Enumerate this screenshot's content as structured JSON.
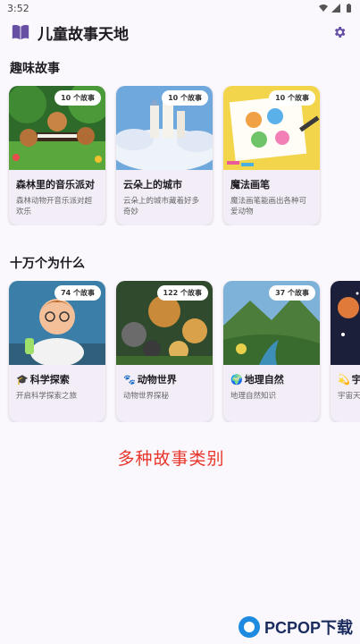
{
  "status_bar": {
    "time": "3:52"
  },
  "header": {
    "title": "儿童故事天地",
    "logo_icon": "book-icon",
    "settings_icon": "gear-icon"
  },
  "sections": [
    {
      "title": "趣味故事",
      "cards": [
        {
          "badge": "10 个故事",
          "title": "森林里的音乐派对",
          "desc": "森林动物开音乐派对超欢乐",
          "icon": ""
        },
        {
          "badge": "10 个故事",
          "title": "云朵上的城市",
          "desc": "云朵上的城市藏着好多奇妙",
          "icon": ""
        },
        {
          "badge": "10 个故事",
          "title": "魔法画笔",
          "desc": "魔法画笔能画出各种可爱动物",
          "icon": ""
        }
      ]
    },
    {
      "title": "十万个为什么",
      "cards": [
        {
          "badge": "74 个故事",
          "title": "科学探索",
          "desc": "开启科学探索之旅",
          "icon": "graduation-cap-icon",
          "glyph": "🎓"
        },
        {
          "badge": "122 个故事",
          "title": "动物世界",
          "desc": "动物世界探秘",
          "icon": "paw-icon",
          "glyph": "🐾"
        },
        {
          "badge": "37 个故事",
          "title": "地理自然",
          "desc": "地理自然知识",
          "icon": "globe-icon",
          "glyph": "🌍"
        },
        {
          "badge": "",
          "title": "宇",
          "desc": "宇宙天",
          "icon": "comet-icon",
          "glyph": "💫"
        }
      ]
    }
  ],
  "promo_text": "多种故事类别",
  "watermark": {
    "text": "PCPOP下载"
  },
  "colors": {
    "accent": "#6750a4",
    "promo": "#e8362c",
    "card_bg": "#f2edf7"
  }
}
